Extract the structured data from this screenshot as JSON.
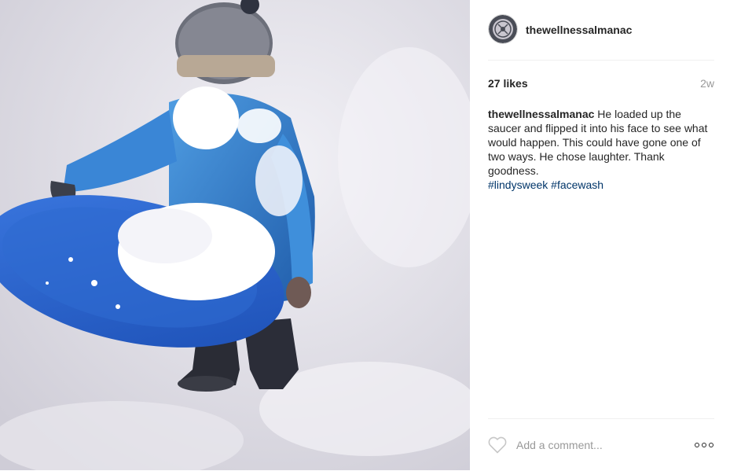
{
  "post": {
    "username": "thewellnessalmanac",
    "likes": "27 likes",
    "timestamp": "2w",
    "caption": {
      "author": "thewellnessalmanac",
      "text": "He loaded up the saucer and flipped it into his face to see what would happen. This could have gone one of two ways. He chose laughter. Thank goodness.",
      "hashtags": [
        "#lindysweek",
        "#facewash"
      ]
    }
  },
  "photo": {
    "subject": "child in blue snowsuit holding blue snow saucer"
  },
  "comment": {
    "placeholder": "Add a comment..."
  },
  "icons": {
    "like": "heart-icon",
    "more": "more-options-icon",
    "avatar": "avatar-logo"
  },
  "colors": {
    "text": "#262626",
    "muted": "#999999",
    "hashtag": "#003569",
    "divider": "#efefef"
  }
}
